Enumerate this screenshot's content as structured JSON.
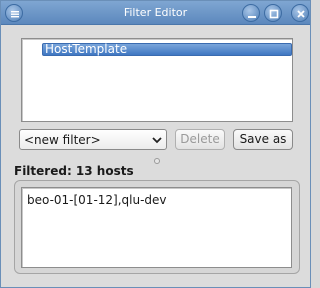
{
  "window": {
    "title": "Filter Editor"
  },
  "filter_list": {
    "items": [
      "HostTemplate"
    ],
    "selected_index": 0
  },
  "controls": {
    "filter_select_value": "<new filter>",
    "delete_label": "Delete",
    "save_as_label": "Save as"
  },
  "result": {
    "filtered_label": "Filtered: 13 hosts",
    "host_expression": "beo-01-[01-12],qlu-dev"
  },
  "icons": {
    "menu": "menu-icon",
    "minimize": "minimize-icon",
    "maximize": "maximize-icon",
    "close": "close-icon",
    "dropdown": "chevron-down-icon"
  },
  "colors": {
    "titlebar": "#6a94c6",
    "selection": "#3f77c2"
  }
}
